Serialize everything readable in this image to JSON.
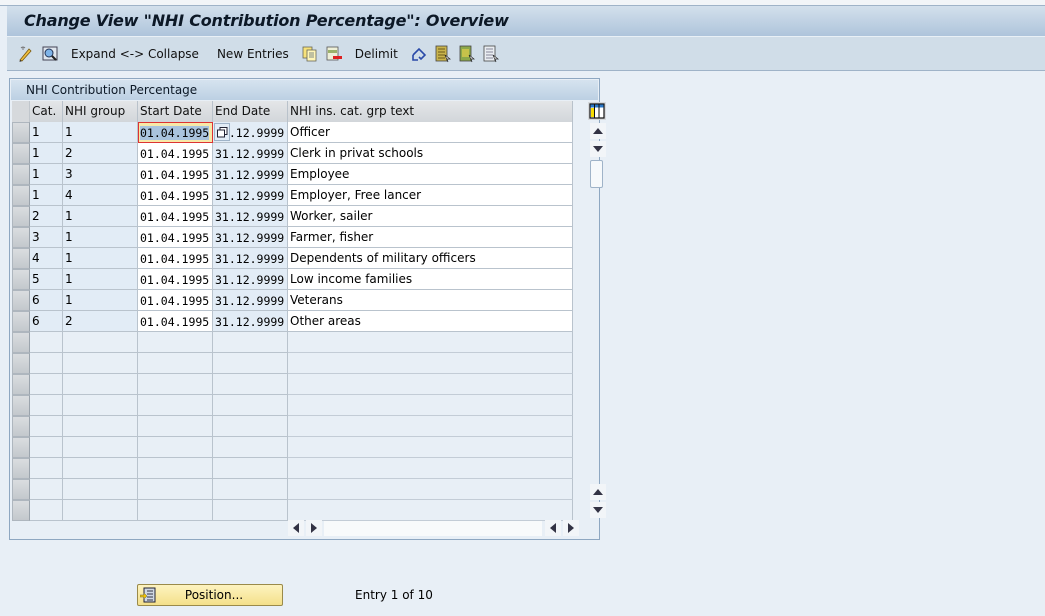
{
  "window": {
    "title": "Change View \"NHI Contribution Percentage\": Overview"
  },
  "toolbar": {
    "items": [
      {
        "type": "icon",
        "name": "change-display-icon"
      },
      {
        "type": "icon",
        "name": "details-icon"
      },
      {
        "type": "text",
        "label": "Expand <-> Collapse"
      },
      {
        "type": "text",
        "label": "New Entries"
      },
      {
        "type": "icon",
        "name": "copy-as-icon"
      },
      {
        "type": "icon",
        "name": "delete-icon"
      },
      {
        "type": "text",
        "label": "Delimit"
      },
      {
        "type": "icon",
        "name": "undo-change-icon"
      },
      {
        "type": "icon",
        "name": "select-all-icon"
      },
      {
        "type": "icon",
        "name": "select-block-icon"
      },
      {
        "type": "icon",
        "name": "deselect-all-icon"
      }
    ]
  },
  "table": {
    "title": "NHI Contribution Percentage",
    "columns": [
      "Cat.",
      "NHI group",
      "Start Date",
      "End Date",
      "NHI ins. cat. grp text"
    ],
    "rows": [
      [
        "1",
        "1",
        "01.04.1995",
        "31.12.9999",
        "Officer"
      ],
      [
        "1",
        "2",
        "01.04.1995",
        "31.12.9999",
        "Clerk in privat schools"
      ],
      [
        "1",
        "3",
        "01.04.1995",
        "31.12.9999",
        "Employee"
      ],
      [
        "1",
        "4",
        "01.04.1995",
        "31.12.9999",
        "Employer, Free lancer"
      ],
      [
        "2",
        "1",
        "01.04.1995",
        "31.12.9999",
        "Worker, sailer"
      ],
      [
        "3",
        "1",
        "01.04.1995",
        "31.12.9999",
        "Farmer, fisher"
      ],
      [
        "4",
        "1",
        "01.04.1995",
        "31.12.9999",
        "Dependents of military officers"
      ],
      [
        "5",
        "1",
        "01.04.1995",
        "31.12.9999",
        "Low income families"
      ],
      [
        "6",
        "1",
        "01.04.1995",
        "31.12.9999",
        "Veterans"
      ],
      [
        "6",
        "2",
        "01.04.1995",
        "31.12.9999",
        "Other areas"
      ]
    ],
    "empty_rows": 9,
    "focused_cell": {
      "row": 0,
      "column": "Start Date"
    },
    "column_settings_icon": "column-config-icon"
  },
  "footer": {
    "position_button": "Position...",
    "entry_text": "Entry 1 of 10"
  },
  "colors": {
    "key_cell": "#e2ecf6",
    "editable_cell": "#ffffff",
    "focus_border": "#dd3333",
    "button_yellow": "#f4e08a"
  }
}
